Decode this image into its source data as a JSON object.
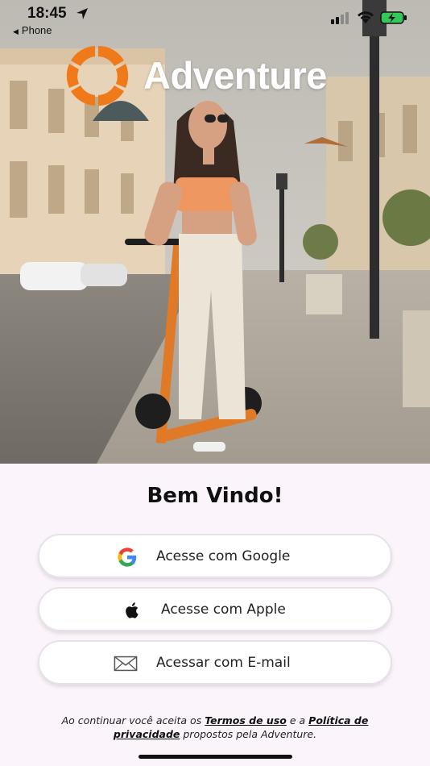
{
  "status_bar": {
    "time": "18:45",
    "back_app": "Phone",
    "icons": [
      "location-arrow-icon",
      "signal-icon",
      "wifi-icon",
      "battery-charging-icon"
    ]
  },
  "brand": {
    "name": "Adventure",
    "accent_color": "#f07a1a"
  },
  "welcome": {
    "title": "Bem Vindo!"
  },
  "auth_buttons": [
    {
      "label": "Acesse com Google",
      "icon": "google-icon"
    },
    {
      "label": "Acesse com Apple",
      "icon": "apple-icon"
    },
    {
      "label": "Acessar com E-mail",
      "icon": "envelope-icon"
    }
  ],
  "terms": {
    "prefix": "Ao continuar você aceita os",
    "terms_link": "Termos de uso",
    "middle": "e a",
    "privacy_link": "Política de privacidade",
    "suffix": "propostos pela Adventure."
  }
}
